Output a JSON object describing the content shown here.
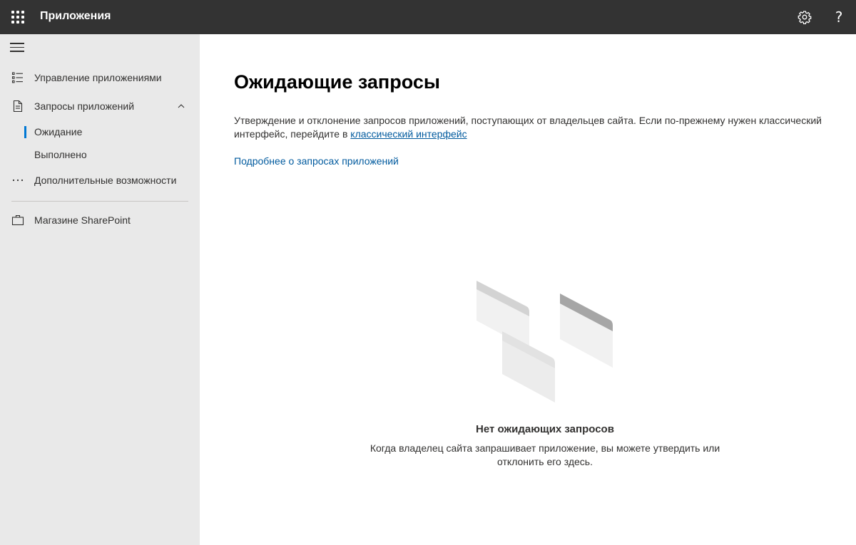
{
  "header": {
    "app_title": "Приложения",
    "icons": {
      "app_launcher": "waffle-icon",
      "settings": "gear-icon",
      "help": "help-icon"
    },
    "help_glyph": "?"
  },
  "sidebar": {
    "collapse_icon": "hamburger-icon",
    "items": [
      {
        "label": "Управление приложениями",
        "icon": "list-icon"
      },
      {
        "label": "Запросы приложений",
        "icon": "document-icon",
        "expanded": true,
        "children": [
          {
            "label": "Ожидание",
            "selected": true
          },
          {
            "label": "Выполнено",
            "selected": false
          }
        ]
      },
      {
        "label": "Дополнительные возможности",
        "icon": "more-icon"
      },
      {
        "label": "Магазине SharePoint",
        "icon": "briefcase-icon"
      }
    ],
    "accent_color": "#0078d4"
  },
  "main": {
    "title": "Ожидающие запросы",
    "description_prefix": "Утверждение и отклонение запросов приложений, поступающих от владельцев сайта. Если по-прежнему нужен классический интерфейс, перейдите в ",
    "description_link": "классический интерфейс",
    "learn_more": "Подробнее о запросах приложений",
    "empty_state": {
      "title": "Нет ожидающих запросов",
      "text": "Когда владелец сайта запрашивает приложение, вы можете утвердить или отклонить его здесь."
    },
    "link_color": "#005a9e"
  }
}
